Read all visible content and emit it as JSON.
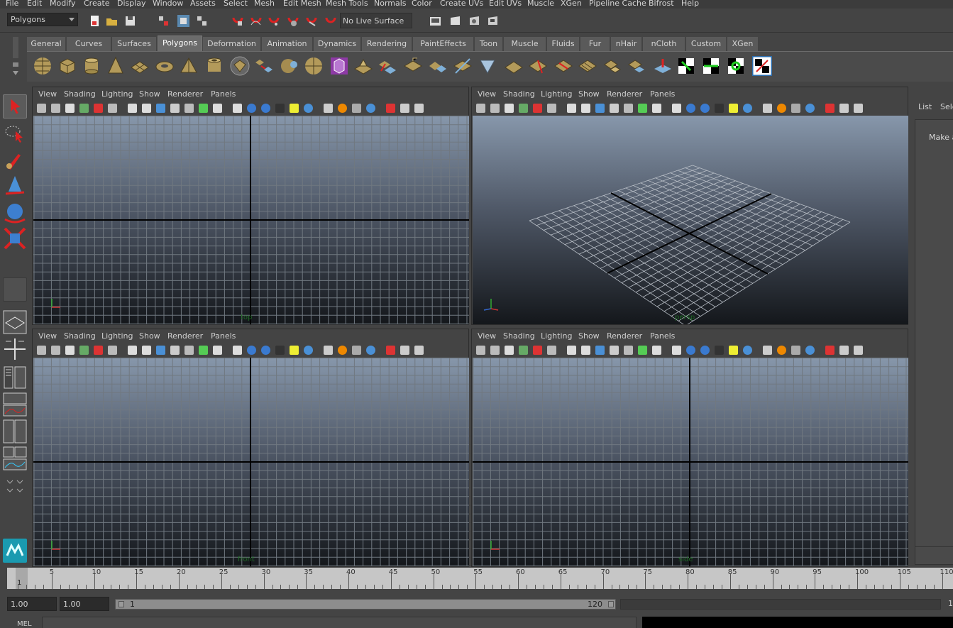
{
  "menubar": {
    "items": [
      "File",
      "Edit",
      "Modify",
      "Create",
      "Display",
      "Window",
      "Assets",
      "Select",
      "Mesh",
      "Edit Mesh",
      "Mesh Tools",
      "Normals",
      "Color",
      "Create UVs",
      "Edit UVs",
      "Muscle",
      "XGen",
      "Pipeline Cache",
      "Bifrost",
      "Help"
    ]
  },
  "statusline": {
    "menu_set": "Polygons",
    "live_surface": "No Live Surface"
  },
  "shelf": {
    "tabs": [
      "General",
      "Curves",
      "Surfaces",
      "Polygons",
      "Deformation",
      "Animation",
      "Dynamics",
      "Rendering",
      "PaintEffects",
      "Toon",
      "Muscle",
      "Fluids",
      "Fur",
      "nHair",
      "nCloth",
      "Custom",
      "XGen"
    ],
    "active_tab": "Polygons"
  },
  "panel_menu": [
    "View",
    "Shading",
    "Lighting",
    "Show",
    "Renderer",
    "Panels"
  ],
  "viewports": {
    "top": {
      "camera": "top"
    },
    "persp": {
      "camera": "persp"
    },
    "front": {
      "camera": "front"
    },
    "side": {
      "camera": "side"
    }
  },
  "channel_box": {
    "tab_list": "List",
    "tab_selected": "Sele",
    "message": "Make a"
  },
  "time_slider": {
    "current_frame": "1",
    "tick_labels": [
      "5",
      "10",
      "15",
      "20",
      "25",
      "30",
      "35",
      "40",
      "45",
      "50",
      "55",
      "60",
      "65",
      "70",
      "75",
      "80",
      "85",
      "90",
      "95",
      "100",
      "105",
      "110"
    ]
  },
  "range_slider": {
    "start_time": "1.00",
    "playback_start": "1.00",
    "range_start": "1",
    "range_end": "120",
    "end_label": "1"
  },
  "command_line": {
    "language": "MEL"
  },
  "colors": {
    "ui_bg": "#444444",
    "menubar_bg": "#3c3c3c",
    "viewport_top": "#8797ab",
    "viewport_bottom": "#14171b",
    "grid_line": "#707880",
    "axis_line": "#000000",
    "timeslider_bg": "#c6c6c6"
  }
}
